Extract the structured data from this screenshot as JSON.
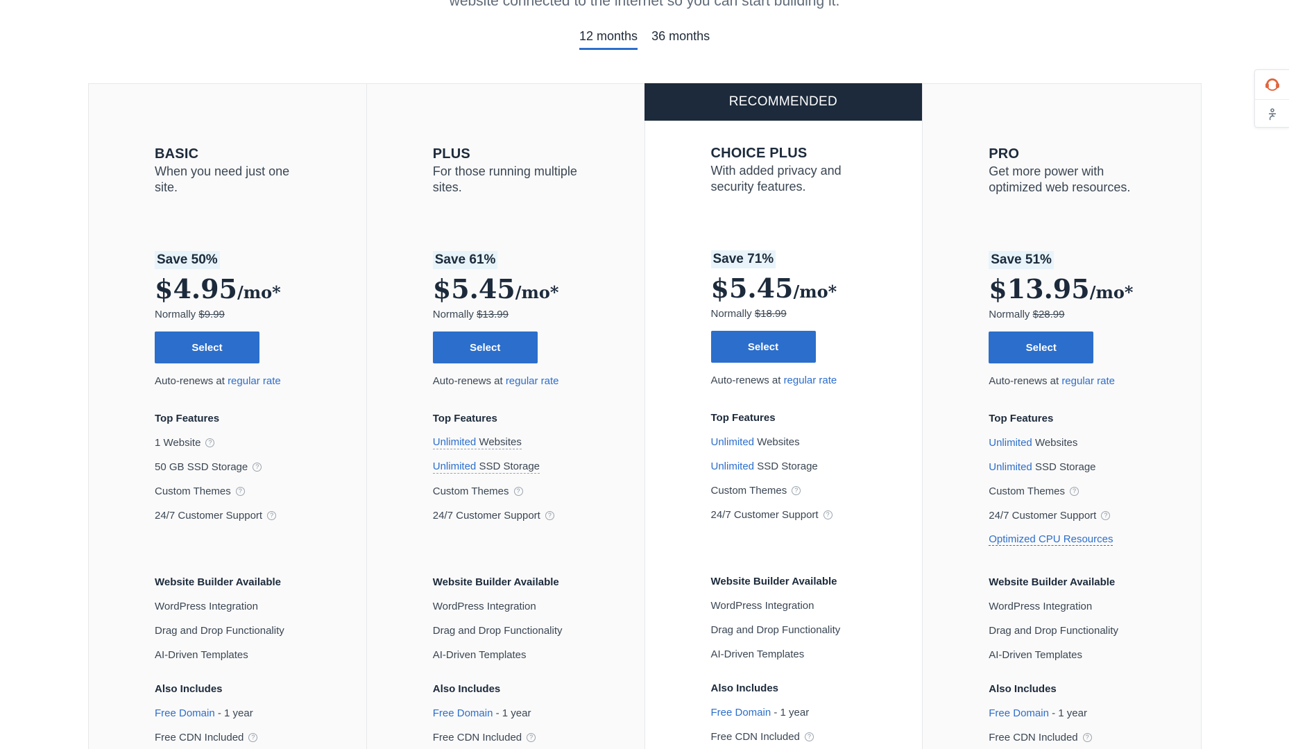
{
  "intro": {
    "text": "website connected to the internet so you can start building it."
  },
  "terms": {
    "tab_12": "12 months",
    "tab_36": "36 months"
  },
  "recommended_label": "RECOMMENDED",
  "common": {
    "select_label": "Select",
    "normally": "Normally",
    "autorenew_prefix": "Auto-renews at",
    "regular_rate": "regular rate",
    "top_features": "Top Features",
    "builder_title": "Website Builder Available",
    "builder_items": [
      "WordPress Integration",
      "Drag and Drop Functionality",
      "AI-Driven Templates"
    ],
    "also_title": "Also Includes",
    "free_domain": "Free Domain",
    "free_domain_suffix": "- 1 year",
    "free_cdn": "Free CDN Included",
    "unlimited": "Unlimited",
    "custom_themes": "Custom Themes",
    "support": "24/7 Customer Support"
  },
  "plans": [
    {
      "name": "BASIC",
      "tagline": "When you need just one site.",
      "save": "Save 50%",
      "price": "$4.95",
      "per": "/mo*",
      "normal_price": "$9.99",
      "websites": "1 Website",
      "storage": "50 GB SSD Storage"
    },
    {
      "name": "PLUS",
      "tagline": "For those running multiple sites.",
      "save": "Save 61%",
      "price": "$5.45",
      "per": "/mo*",
      "normal_price": "$13.99",
      "websites": "Websites",
      "storage": "SSD Storage"
    },
    {
      "name": "CHOICE PLUS",
      "tagline": "With added privacy and security features.",
      "save": "Save 71%",
      "price": "$5.45",
      "per": "/mo*",
      "normal_price": "$18.99",
      "websites": "Websites",
      "storage": "SSD Storage"
    },
    {
      "name": "PRO",
      "tagline": "Get more power with optimized web resources.",
      "save": "Save 51%",
      "price": "$13.95",
      "per": "/mo*",
      "normal_price": "$28.99",
      "websites": "Websites",
      "storage": "SSD Storage",
      "cpu": "Optimized CPU Resources"
    }
  ],
  "icons": {
    "support_widget": "support-headset-icon",
    "accessibility_widget": "accessibility-icon",
    "help": "question-circle-icon"
  },
  "colors": {
    "accent": "#2c6ecb",
    "dark": "#1c2a3b",
    "badge_bg": "#e8f4fa",
    "widget_icon": "#e0633a"
  }
}
